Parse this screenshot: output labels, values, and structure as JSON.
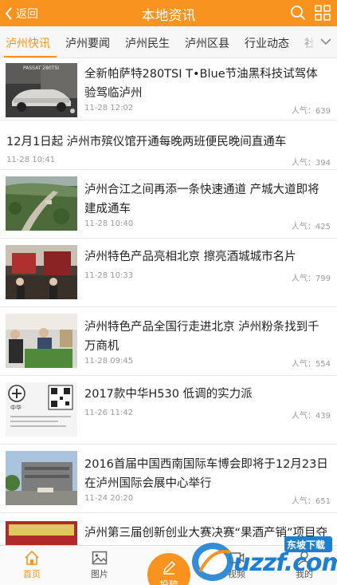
{
  "header": {
    "back_label": "返回",
    "title": "本地资讯"
  },
  "tabs": [
    {
      "label": "泸州快讯",
      "active": true
    },
    {
      "label": "泸州要闻"
    },
    {
      "label": "泸州民生"
    },
    {
      "label": "泸州区县"
    },
    {
      "label": "行业动态"
    },
    {
      "label": "社会"
    }
  ],
  "news": [
    {
      "title": "全新帕萨特280TSI T•Blue节油黑科技试驾体验驾临泸州",
      "date": "11-28 12:02",
      "popularity": "人气：639"
    },
    {
      "title": "12月1日起 泸州市殡仪馆开通每晚两班便民晚间直通车",
      "date": "11-28 10:41",
      "popularity": "人气：394"
    },
    {
      "title": "泸州合江之间再添一条快速通道 产城大道即将建成通车",
      "date": "11-28 10:40",
      "popularity": "人气：425"
    },
    {
      "title": "泸州特色产品亮相北京 擦亮酒城城市名片",
      "date": "11-28 10:33",
      "popularity": "人气：799"
    },
    {
      "title": "泸州特色产品全国行走进北京 泸州粉条找到千万商机",
      "date": "11-28 09:45",
      "popularity": "人气：554"
    },
    {
      "title": "2017款中华H530 低调的实力派",
      "date": "11-26 11:42",
      "popularity": "人气：439"
    },
    {
      "title": "2016首届中国西南国际车博会即将于12月23日在泸州国际会展中心举行",
      "date": "11-24 20:20",
      "popularity": "人气：651"
    },
    {
      "title": "泸州第三届创新创业大赛决赛“果酒产销”项目夺冠",
      "date": "",
      "popularity": ""
    }
  ],
  "thumb_text": {
    "car_plate": "PASSAT 280TSI",
    "brand_cn": "中华"
  },
  "bottom_nav": [
    {
      "label": "首页",
      "icon": "home-icon",
      "active": true
    },
    {
      "label": "图片",
      "icon": "image-icon"
    },
    {
      "label": "投稿",
      "icon": "pen-icon"
    },
    {
      "label": "视频",
      "icon": "video-icon"
    },
    {
      "label": "我的",
      "icon": "user-icon"
    }
  ],
  "watermark": {
    "text": "uzzf.com",
    "sub": "东坡下载"
  },
  "colors": {
    "accent": "#f7931e",
    "watermark_blue": "#1c7fd1"
  }
}
